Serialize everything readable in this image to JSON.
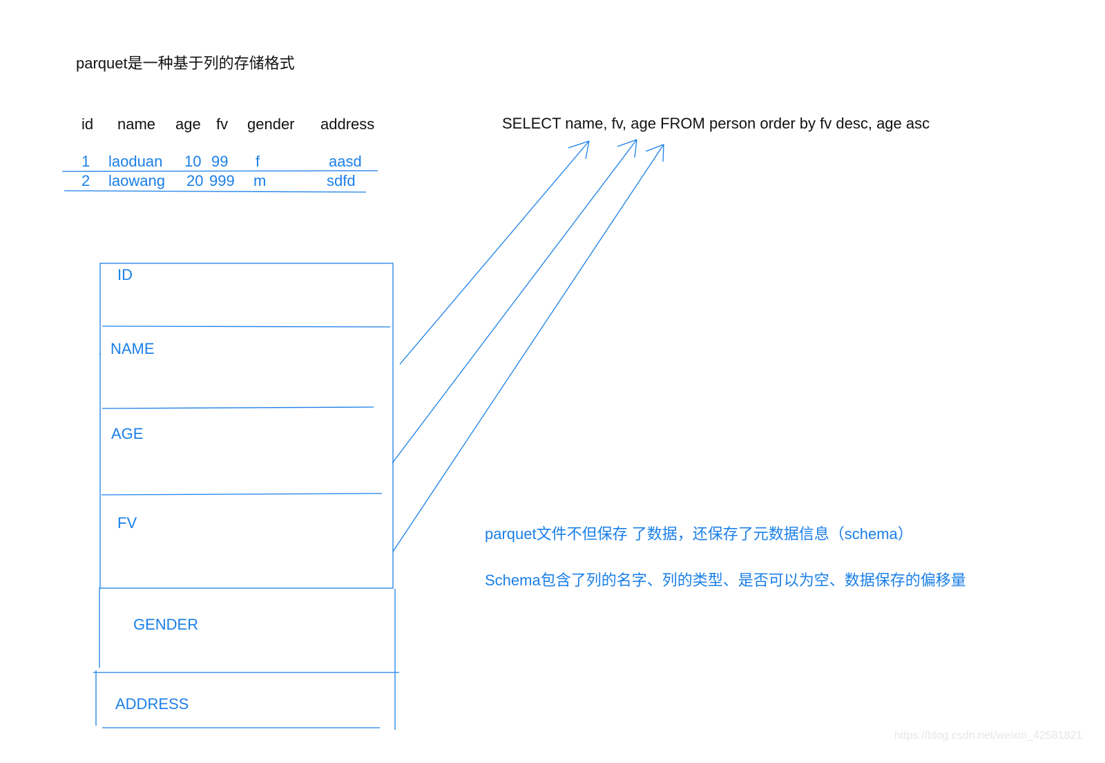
{
  "title": "parquet是一种基于列的存储格式",
  "table": {
    "headers": [
      "id",
      "name",
      "age",
      "fv",
      "gender",
      "address"
    ],
    "rows": [
      [
        "1",
        "laoduan",
        "10",
        "99",
        "f",
        "aasd"
      ],
      [
        "2",
        "laowang",
        "20",
        "999",
        "m",
        "sdfd"
      ]
    ]
  },
  "sql": "SELECT name, fv, age FROM person order by fv desc, age asc",
  "column_blocks": [
    "ID",
    "NAME",
    "AGE",
    "FV",
    "GENDER",
    "ADDRESS"
  ],
  "arrows": [
    {
      "from": "NAME",
      "to": "name"
    },
    {
      "from": "AGE",
      "to": "fv"
    },
    {
      "from": "FV",
      "to": "age"
    }
  ],
  "notes": [
    "parquet文件不但保存 了数据，还保存了元数据信息（schema）",
    "Schema包含了列的名字、列的类型、是否可以为空、数据保存的偏移量"
  ],
  "watermark": "https://blog.csdn.net/weixin_42581821",
  "colors": {
    "accent": "#1a7fe8",
    "text": "#111111"
  }
}
